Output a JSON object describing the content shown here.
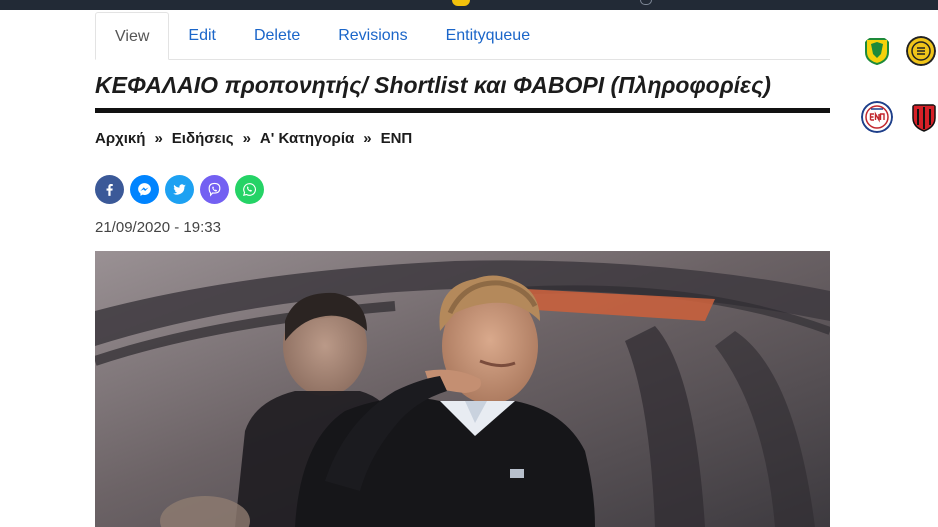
{
  "tabs": [
    {
      "label": "View",
      "active": true
    },
    {
      "label": "Edit"
    },
    {
      "label": "Delete"
    },
    {
      "label": "Revisions"
    },
    {
      "label": "Entityqueue"
    }
  ],
  "article": {
    "title": "ΚΕΦΑΛΑΙΟ προπονητής/ Shortlist και ΦΑΒΟΡΙ (Πληροφορίες)",
    "date": "21/09/2020 - 19:33"
  },
  "breadcrumb": {
    "separator": "»",
    "items": [
      "Αρχική",
      "Ειδήσεις",
      "Α' Κατηγορία",
      "ΕΝΠ"
    ]
  },
  "share": [
    {
      "icon": "facebook-icon",
      "color": "#3b5998"
    },
    {
      "icon": "messenger-icon",
      "color": "#0084ff"
    },
    {
      "icon": "twitter-icon",
      "color": "#1da1f2"
    },
    {
      "icon": "viber-icon",
      "color": "#7360f2"
    },
    {
      "icon": "whatsapp-icon",
      "color": "#25d366"
    }
  ],
  "colors": {
    "link": "#1b66c9",
    "topbar": "#222a36",
    "accent_yellow": "#f2c10c"
  },
  "sidebar_crests": [
    {
      "icon": "club-crest-icon",
      "colors": [
        "#f4d20b",
        "#1d8a3a"
      ]
    },
    {
      "icon": "club-crest-icon",
      "colors": [
        "#f0c419",
        "#222222"
      ]
    },
    {
      "icon": "enp-crest-icon",
      "colors": [
        "#c2272d",
        "#1e3f8a"
      ],
      "text": "ENП"
    },
    {
      "icon": "club-crest-icon",
      "colors": [
        "#d62027",
        "#111111"
      ]
    }
  ]
}
